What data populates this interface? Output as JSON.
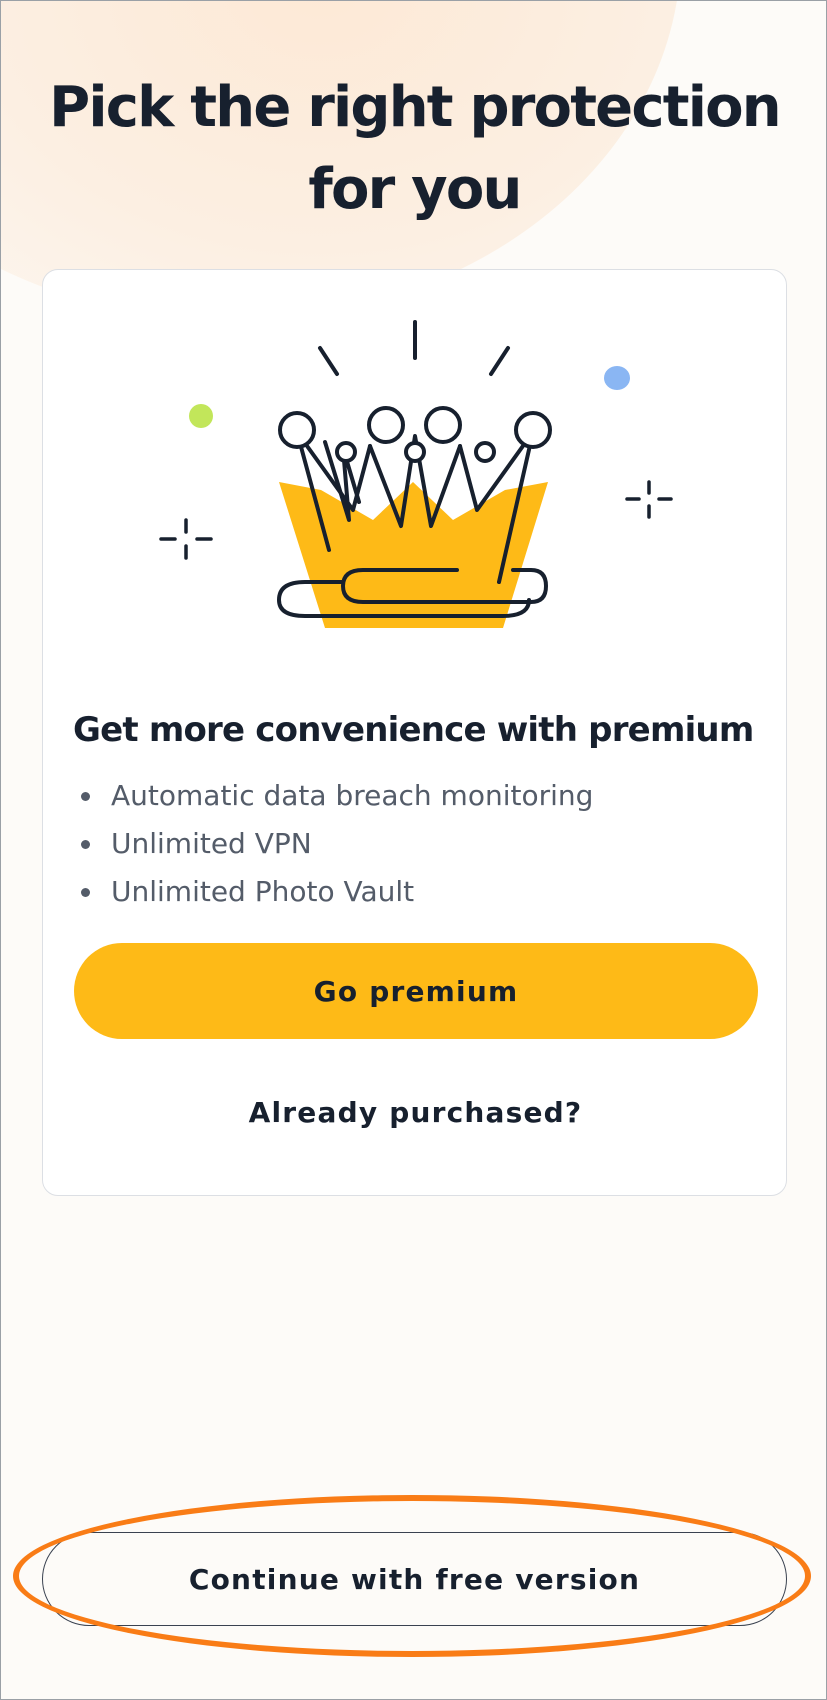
{
  "page": {
    "title": "Pick the right protection for you"
  },
  "card": {
    "illustration_icon": "crown-icon",
    "heading": "Get more convenience with premium",
    "features": [
      "Automatic data breach monitoring",
      "Unlimited VPN",
      "Unlimited Photo Vault"
    ],
    "primary_button_label": "Go premium",
    "secondary_link_label": "Already purchased?"
  },
  "footer": {
    "free_button_label": "Continue with free version"
  },
  "colors": {
    "accent_yellow": "#feba17",
    "text_dark": "#17202e",
    "text_muted": "#545c69",
    "highlight_orange": "#f97c16",
    "confetti_green": "#c2e65a",
    "confetti_blue": "#8ab6f3"
  }
}
